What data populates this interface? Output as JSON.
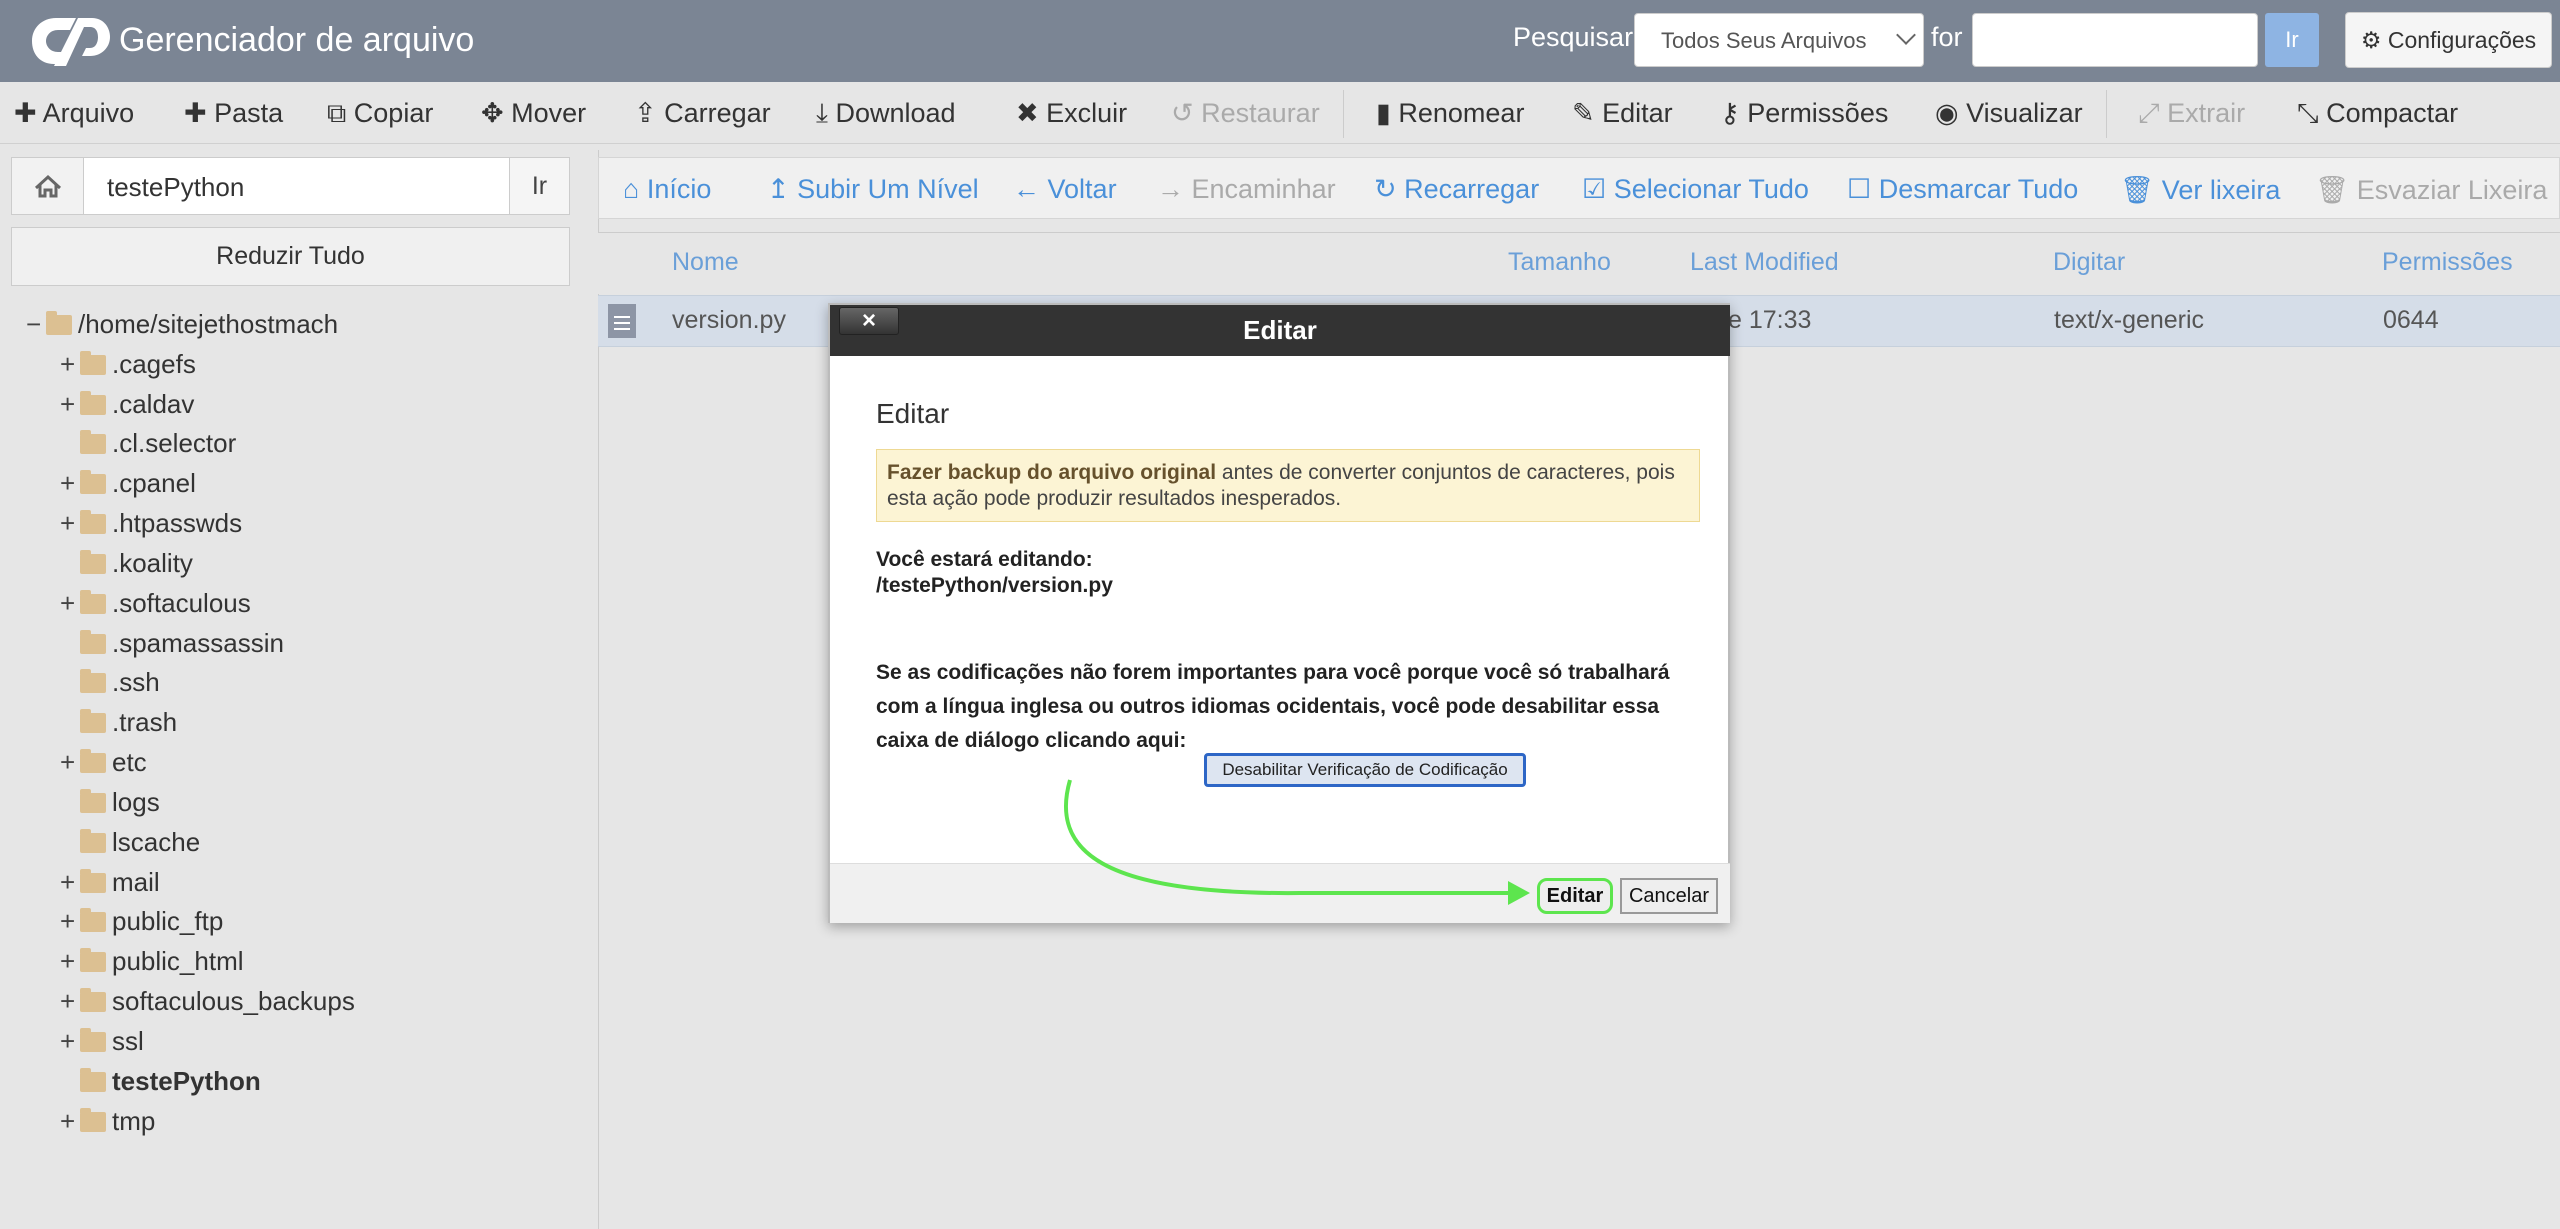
{
  "header": {
    "app_title": "Gerenciador de arquivo",
    "search_label": "Pesquisar",
    "search_scope": "Todos Seus Arquivos",
    "for_label": "for",
    "search_placeholder": "",
    "go_label": "Ir",
    "settings_label": "Configurações"
  },
  "toolbar": {
    "items": [
      {
        "label": "Arquivo",
        "icon": "plus-icon"
      },
      {
        "label": "Pasta",
        "icon": "plus-icon"
      },
      {
        "label": "Copiar",
        "icon": "copy-icon"
      },
      {
        "label": "Mover",
        "icon": "move-icon"
      },
      {
        "label": "Carregar",
        "icon": "upload-icon"
      },
      {
        "label": "Download",
        "icon": "download-icon"
      },
      {
        "label": "Excluir",
        "icon": "x-icon"
      },
      {
        "label": "Restaurar",
        "icon": "undo-icon"
      },
      {
        "label": "Renomear",
        "icon": "file-icon"
      },
      {
        "label": "Editar",
        "icon": "pencil-icon"
      },
      {
        "label": "Permissões",
        "icon": "key-icon"
      },
      {
        "label": "Visualizar",
        "icon": "eye-icon"
      },
      {
        "label": "Extrair",
        "icon": "expand-icon"
      },
      {
        "label": "Compactar",
        "icon": "compress-icon"
      }
    ]
  },
  "left": {
    "path_value": "testePython",
    "path_go": "Ir",
    "collapse_label": "Reduzir Tudo",
    "tree": [
      {
        "label": "/home/sitejethostmach",
        "expander": "−"
      },
      {
        "label": ".cagefs",
        "expander": "+"
      },
      {
        "label": ".caldav",
        "expander": "+"
      },
      {
        "label": ".cl.selector",
        "expander": ""
      },
      {
        "label": ".cpanel",
        "expander": "+"
      },
      {
        "label": ".htpasswds",
        "expander": "+"
      },
      {
        "label": ".koality",
        "expander": ""
      },
      {
        "label": ".softaculous",
        "expander": "+"
      },
      {
        "label": ".spamassassin",
        "expander": ""
      },
      {
        "label": ".ssh",
        "expander": ""
      },
      {
        "label": ".trash",
        "expander": ""
      },
      {
        "label": "etc",
        "expander": "+"
      },
      {
        "label": "logs",
        "expander": ""
      },
      {
        "label": "lscache",
        "expander": ""
      },
      {
        "label": "mail",
        "expander": "+"
      },
      {
        "label": "public_ftp",
        "expander": "+"
      },
      {
        "label": "public_html",
        "expander": "+"
      },
      {
        "label": "softaculous_backups",
        "expander": "+"
      },
      {
        "label": "ssl",
        "expander": "+"
      },
      {
        "label": "testePython",
        "expander": ""
      },
      {
        "label": "tmp",
        "expander": "+"
      }
    ]
  },
  "nav": {
    "items": [
      {
        "label": "Início",
        "icon": "home-icon"
      },
      {
        "label": "Subir Um Nível",
        "icon": "level-up-icon"
      },
      {
        "label": "Voltar",
        "icon": "arrow-left-icon"
      },
      {
        "label": "Encaminhar",
        "icon": "arrow-right-icon"
      },
      {
        "label": "Recarregar",
        "icon": "refresh-icon"
      },
      {
        "label": "Selecionar Tudo",
        "icon": "checkbox-checked-icon"
      },
      {
        "label": "Desmarcar Tudo",
        "icon": "checkbox-icon"
      },
      {
        "label": "Ver lixeira",
        "icon": "trash-icon"
      },
      {
        "label": "Esvaziar Lixeira",
        "icon": "trash-icon"
      }
    ]
  },
  "table": {
    "headers": [
      "Nome",
      "Tamanho",
      "Last Modified",
      "Digitar",
      "Permissões"
    ],
    "rows": [
      {
        "name": "version.py",
        "modified": "e 17:33",
        "type": "text/x-generic",
        "perms": "0644"
      }
    ]
  },
  "modal": {
    "header": "Editar",
    "close": "×",
    "title": "Editar",
    "warning_bold": "Fazer backup do arquivo original",
    "warning_rest": " antes de converter conjuntos de caracteres, pois esta ação pode produzir resultados inesperados.",
    "editing_label": "Você estará editando:",
    "editing_path": "/testePython/version.py",
    "encoding_text": "Se as codificações não forem importantes para você porque você só trabalhará com a língua inglesa ou outros idiomas ocidentais, você pode desabilitar essa caixa de diálogo clicando aqui:",
    "disable_button": "Desabilitar Verificação de Codificação",
    "edit_button": "Editar",
    "cancel_button": "Cancelar"
  },
  "colors": {
    "header_bg": "#7b8594",
    "link": "#4a90d9",
    "highlight": "#5de54e",
    "folder": "#dcc092"
  }
}
